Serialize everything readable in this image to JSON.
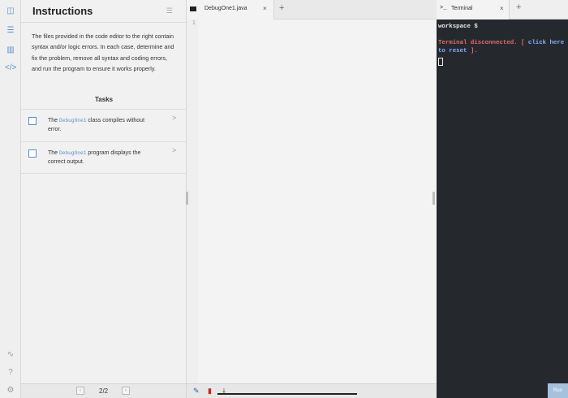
{
  "instructions": {
    "title": "Instructions",
    "body": "The files provided in the code editor to the right contain syntax and/or logic errors. In each case, determine and fix the problem, remove all syntax and coding errors, and run the program to ensure it works properly.",
    "tasks_title": "Tasks",
    "tasks": [
      {
        "pre": "The ",
        "code": "DebugOne1",
        "post": " class compiles without error."
      },
      {
        "pre": "The ",
        "code": "DebugOne1",
        "post": " program displays the correct output."
      }
    ],
    "pagination": "2/2"
  },
  "editor": {
    "tab_label": "DebugOne1.java",
    "line_number": "1"
  },
  "terminal": {
    "tab_label": "Terminal",
    "prompt": "workspace $",
    "msg_prefix": "Terminal disconnected. [ ",
    "msg_link": "click here to reset",
    "msg_suffix": " ]."
  },
  "run_label": "Run",
  "colors": {
    "accent": "#5a8fc7",
    "terminal_bg": "#25292e",
    "error": "#e26a6a",
    "link": "#7fb0ff"
  }
}
